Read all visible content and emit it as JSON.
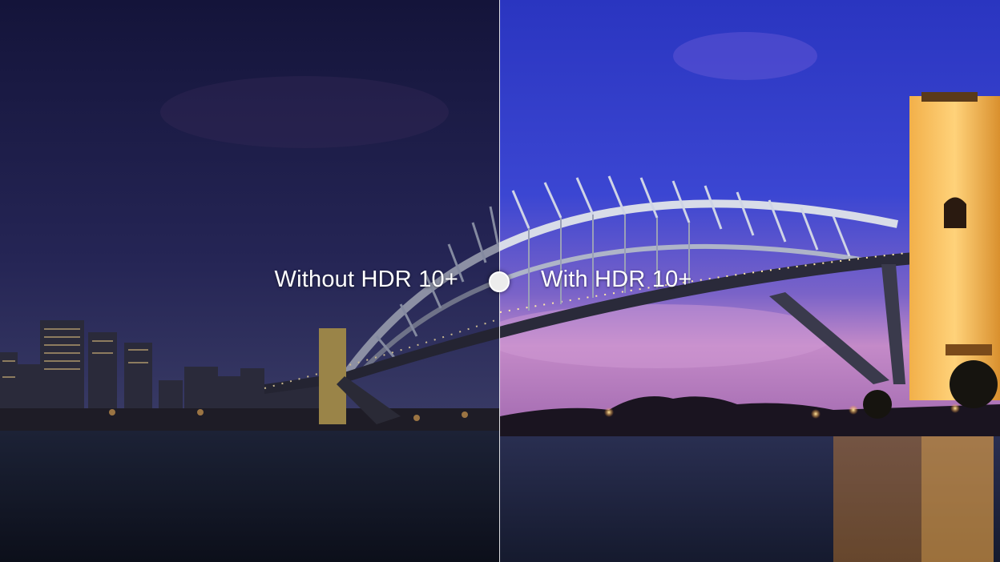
{
  "comparison": {
    "left_label": "Without HDR 10+",
    "right_label": "With HDR 10+",
    "handle_icon": "slider-handle-icon",
    "split_position_fraction": 0.5
  },
  "colors": {
    "sky_dark": "#1c1b4a",
    "sky_vivid": "#3a45c8",
    "sunset_pink": "#c48ac8",
    "light_glow": "#ffb347",
    "water_dark": "#141a2a"
  }
}
